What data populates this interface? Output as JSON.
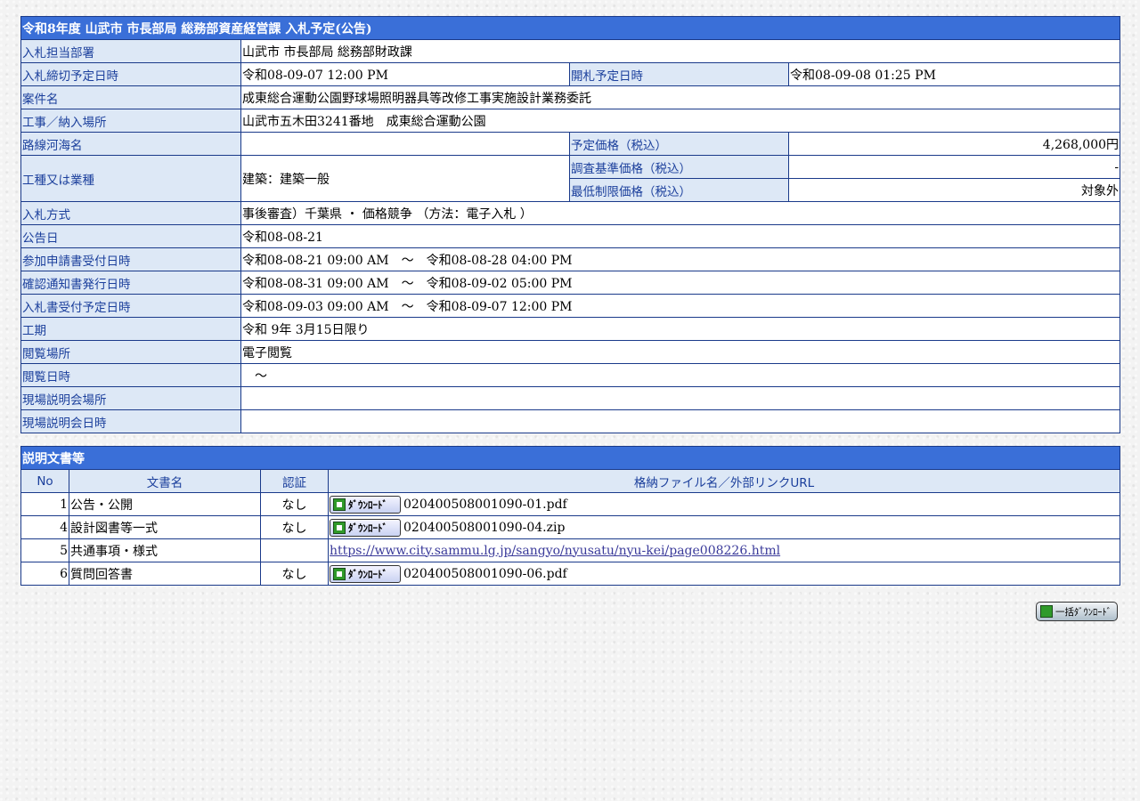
{
  "notice": {
    "title": "令和8年度 山武市 市長部局 総務部資産経営課 入札予定(公告)",
    "rows": {
      "dept": {
        "label": "入札担当部署",
        "value": "山武市 市長部局 総務部財政課"
      },
      "deadline": {
        "label": "入札締切予定日時",
        "value": "令和08-09-07 12:00 PM"
      },
      "opening": {
        "label": "開札予定日時",
        "value": "令和08-09-08 01:25 PM"
      },
      "case": {
        "label": "案件名",
        "value": "成東総合運動公園野球場照明器具等改修工事実施設計業務委託"
      },
      "place": {
        "label": "工事／納入場所",
        "value": "山武市五木田3241番地　成東総合運動公園"
      },
      "route": {
        "label": "路線河海名",
        "value": ""
      },
      "planned_price": {
        "label": "予定価格（税込）",
        "value": "4,268,000円"
      },
      "work_type": {
        "label": "工種又は業種",
        "value": "建築：建築一般"
      },
      "survey_price": {
        "label": "調査基準価格（税込）",
        "value": "-"
      },
      "min_price": {
        "label": "最低制限価格（税込）",
        "value": "対象外"
      },
      "method": {
        "label": "入札方式",
        "value": "事後審査）千葉県 ・ 価格競争 （方法：電子入札 ）"
      },
      "announce": {
        "label": "公告日",
        "value": "令和08-08-21"
      },
      "application": {
        "label": "参加申請書受付日時",
        "value": "令和08-08-21 09:00 AM　～　令和08-08-28 04:00 PM"
      },
      "confirm": {
        "label": "確認通知書発行日時",
        "value": "令和08-08-31 09:00 AM　～　令和08-09-02 05:00 PM"
      },
      "bid_receipt": {
        "label": "入札書受付予定日時",
        "value": "令和08-09-03 09:00 AM　～　令和08-09-07 12:00 PM"
      },
      "period": {
        "label": "工期",
        "value": "令和 9年 3月15日限り"
      },
      "view_place": {
        "label": "閲覧場所",
        "value": "電子閲覧"
      },
      "view_date": {
        "label": "閲覧日時",
        "value": "　～"
      },
      "site_place": {
        "label": "現場説明会場所",
        "value": ""
      },
      "site_date": {
        "label": "現場説明会日時",
        "value": ""
      }
    }
  },
  "docs": {
    "title": "説明文書等",
    "headers": {
      "no": "No",
      "name": "文書名",
      "auth": "認証",
      "file": "格納ファイル名／外部リンクURL"
    },
    "download_label": "ﾀﾞｳﾝﾛｰﾄﾞ",
    "rows": [
      {
        "no": "1",
        "name": "公告・公開",
        "auth": "なし",
        "file": "020400508001090-01.pdf"
      },
      {
        "no": "4",
        "name": "設計図書等一式",
        "auth": "なし",
        "file": "020400508001090-04.zip"
      },
      {
        "no": "5",
        "name": "共通事項・様式",
        "auth": "",
        "link": "https://www.city.sammu.lg.jp/sangyo/nyusatu/nyu-kei/page008226.html"
      },
      {
        "no": "6",
        "name": "質問回答書",
        "auth": "なし",
        "file": "020400508001090-06.pdf"
      }
    ],
    "bulk_label": "一括ﾀﾞｳﾝﾛｰﾄﾞ"
  }
}
